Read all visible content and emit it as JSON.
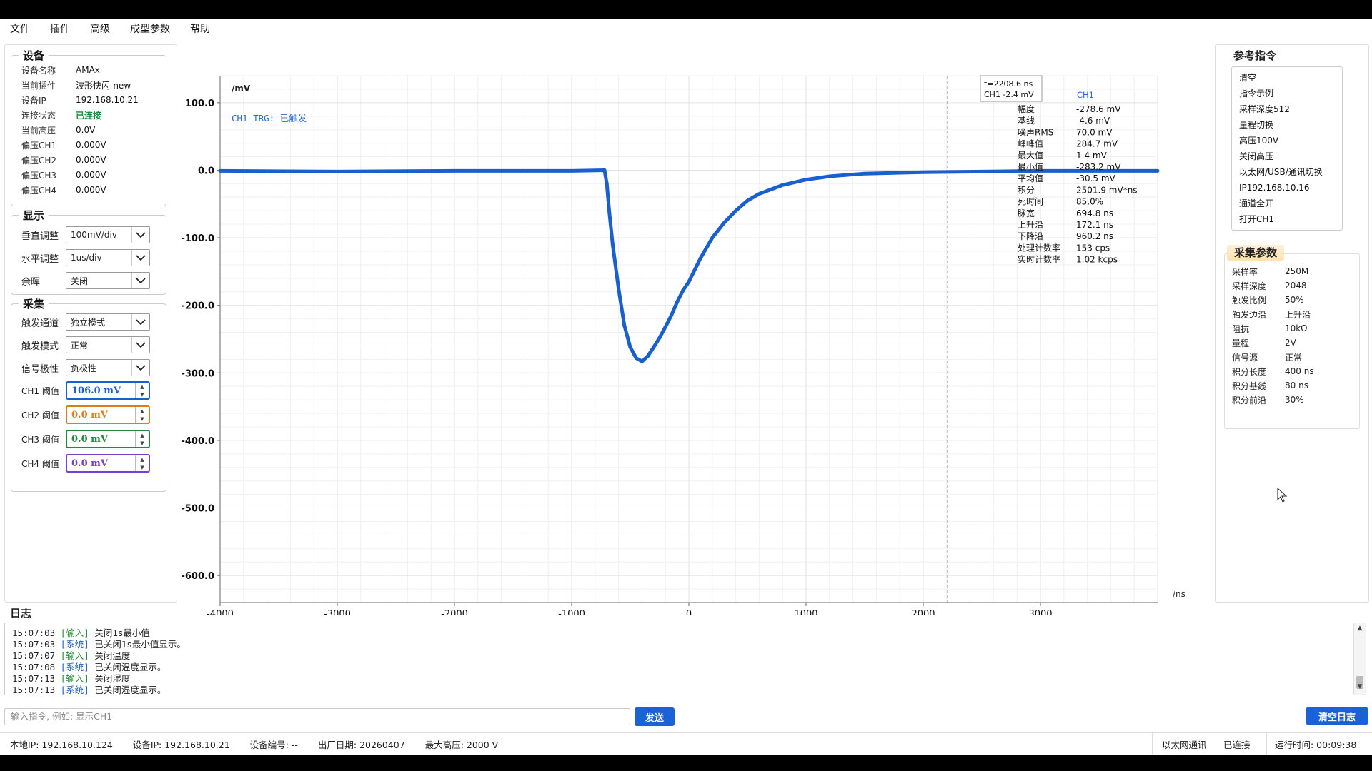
{
  "menu": [
    "文件",
    "插件",
    "高级",
    "成型参数",
    "帮助"
  ],
  "device": {
    "title": "设备",
    "rows": [
      {
        "k": "设备名称",
        "v": "AMAx"
      },
      {
        "k": "当前插件",
        "v": "波形快闪-new"
      },
      {
        "k": "设备IP",
        "v": "192.168.10.21"
      },
      {
        "k": "连接状态",
        "v": "已连接"
      },
      {
        "k": "当前高压",
        "v": "0.0V"
      },
      {
        "k": "偏压CH1",
        "v": "0.000V"
      },
      {
        "k": "偏压CH2",
        "v": "0.000V"
      },
      {
        "k": "偏压CH3",
        "v": "0.000V"
      },
      {
        "k": "偏压CH4",
        "v": "0.000V"
      }
    ]
  },
  "display": {
    "title": "显示",
    "vertical": {
      "label": "垂直调整",
      "value": "100mV/div"
    },
    "horizontal": {
      "label": "水平调整",
      "value": "1us/div"
    },
    "afterglow": {
      "label": "余晖",
      "value": "关闭"
    }
  },
  "acquire": {
    "title": "采集",
    "trigger_channel": {
      "label": "触发通道",
      "value": "独立模式"
    },
    "trigger_mode": {
      "label": "触发模式",
      "value": "正常"
    },
    "polarity": {
      "label": "信号极性",
      "value": "负极性"
    },
    "thresholds": [
      {
        "label": "CH1 阈值",
        "value": "106.0 mV",
        "color": "#1a5fd0"
      },
      {
        "label": "CH2 阈值",
        "value": "0.0 mV",
        "color": "#e07b1a"
      },
      {
        "label": "CH3 阈值",
        "value": "0.0 mV",
        "color": "#1f8a3a"
      },
      {
        "label": "CH4 阈值",
        "value": "0.0 mV",
        "color": "#7a3fd0"
      }
    ]
  },
  "chart": {
    "y_unit": "/mV",
    "x_unit": "/ns",
    "trigger_status": "CH1 TRG: 已触发",
    "cursor_readout": [
      "t=2208.6 ns",
      "CH1 -2.4 mV"
    ],
    "measure_channel": "CH1",
    "measurements": [
      {
        "k": "幅度",
        "v": "-278.6 mV"
      },
      {
        "k": "基线",
        "v": "-4.6 mV"
      },
      {
        "k": "噪声RMS",
        "v": "70.0 mV"
      },
      {
        "k": "峰峰值",
        "v": "284.7 mV"
      },
      {
        "k": "最大值",
        "v": "1.4 mV"
      },
      {
        "k": "最小值",
        "v": "-283.2 mV"
      },
      {
        "k": "平均值",
        "v": "-30.5 mV"
      },
      {
        "k": "积分",
        "v": "2501.9 mV*ns"
      },
      {
        "k": "死时间",
        "v": "85.0%"
      },
      {
        "k": "脉宽",
        "v": "694.8 ns"
      },
      {
        "k": "上升沿",
        "v": "172.1 ns"
      },
      {
        "k": "下降沿",
        "v": "960.2 ns"
      },
      {
        "k": "处理计数率",
        "v": "153 cps"
      },
      {
        "k": "实时计数率",
        "v": "1.02 kcps"
      }
    ]
  },
  "chart_data": {
    "type": "line",
    "x_ticks": [
      "-4000",
      "-3000",
      "-2000",
      "-1000",
      "0",
      "1000",
      "2000",
      "3000"
    ],
    "y_ticks": [
      "100.0",
      "0.0",
      "-100.0",
      "-200.0",
      "-300.0",
      "-400.0",
      "-500.0",
      "-600.0"
    ],
    "xlim": [
      -4000,
      4000
    ],
    "ylim": [
      -640,
      140
    ],
    "grid": true,
    "cursor_x": 2208.6,
    "series": [
      {
        "name": "CH1",
        "color": "#1a5fd0",
        "x": [
          -4000,
          -3000,
          -2000,
          -1000,
          -720,
          -700,
          -680,
          -650,
          -600,
          -550,
          -500,
          -450,
          -400,
          -350,
          -300,
          -250,
          -200,
          -150,
          -100,
          -50,
          0,
          100,
          200,
          300,
          400,
          500,
          600,
          800,
          1000,
          1200,
          1500,
          2000,
          2500,
          3000,
          3500,
          4000
        ],
        "y": [
          -1,
          -2,
          -1,
          -1,
          0,
          -20,
          -60,
          -110,
          -175,
          -230,
          -262,
          -278,
          -283,
          -275,
          -262,
          -248,
          -232,
          -215,
          -195,
          -178,
          -165,
          -130,
          -100,
          -78,
          -60,
          -45,
          -35,
          -22,
          -14,
          -9,
          -5,
          -3,
          -2,
          -1,
          -1,
          -1
        ]
      }
    ]
  },
  "reference": {
    "title": "参考指令",
    "items": [
      "清空",
      "指令示例",
      "采样深度512",
      "量程切换",
      "高压100V",
      "关闭高压",
      "以太网/USB/通讯切换",
      "IP192.168.10.16",
      "通道全开",
      "打开CH1"
    ]
  },
  "acq_params": {
    "title": "采集参数",
    "rows": [
      {
        "k": "采样率",
        "v": "250M"
      },
      {
        "k": "采样深度",
        "v": "2048"
      },
      {
        "k": "触发比例",
        "v": "50%"
      },
      {
        "k": "触发边沿",
        "v": "上升沿"
      },
      {
        "k": "阻抗",
        "v": "10kΩ"
      },
      {
        "k": "量程",
        "v": "2V"
      },
      {
        "k": "信号源",
        "v": "正常"
      },
      {
        "k": "积分长度",
        "v": "400 ns"
      },
      {
        "k": "积分基线",
        "v": "80 ns"
      },
      {
        "k": "积分前沿",
        "v": "30%"
      }
    ]
  },
  "log": {
    "title": "日志",
    "lines": [
      {
        "t": "15:07:03",
        "tag": "[输入]",
        "type": "in",
        "msg": "关闭1s最小值"
      },
      {
        "t": "15:07:03",
        "tag": "[系统]",
        "type": "sys",
        "msg": "已关闭1s最小值显示。"
      },
      {
        "t": "15:07:07",
        "tag": "[输入]",
        "type": "in",
        "msg": "关闭温度"
      },
      {
        "t": "15:07:08",
        "tag": "[系统]",
        "type": "sys",
        "msg": "已关闭温度显示。"
      },
      {
        "t": "15:07:13",
        "tag": "[输入]",
        "type": "in",
        "msg": "关闭湿度"
      },
      {
        "t": "15:07:13",
        "tag": "[系统]",
        "type": "sys",
        "msg": "已关闭湿度显示。"
      }
    ]
  },
  "command": {
    "placeholder": "输入指令, 例如: 显示CH1",
    "send_label": "发送",
    "clear_label": "清空日志"
  },
  "status": {
    "local_ip": "本地IP: 192.168.10.124",
    "device_ip": "设备IP: 192.168.10.21",
    "device_no": "设备编号: --",
    "factory_date": "出厂日期: 20260407",
    "max_hv": "最大高压: 2000 V",
    "comm": "以太网通讯",
    "conn": "已连接",
    "runtime": "运行时间: 00:09:38"
  }
}
